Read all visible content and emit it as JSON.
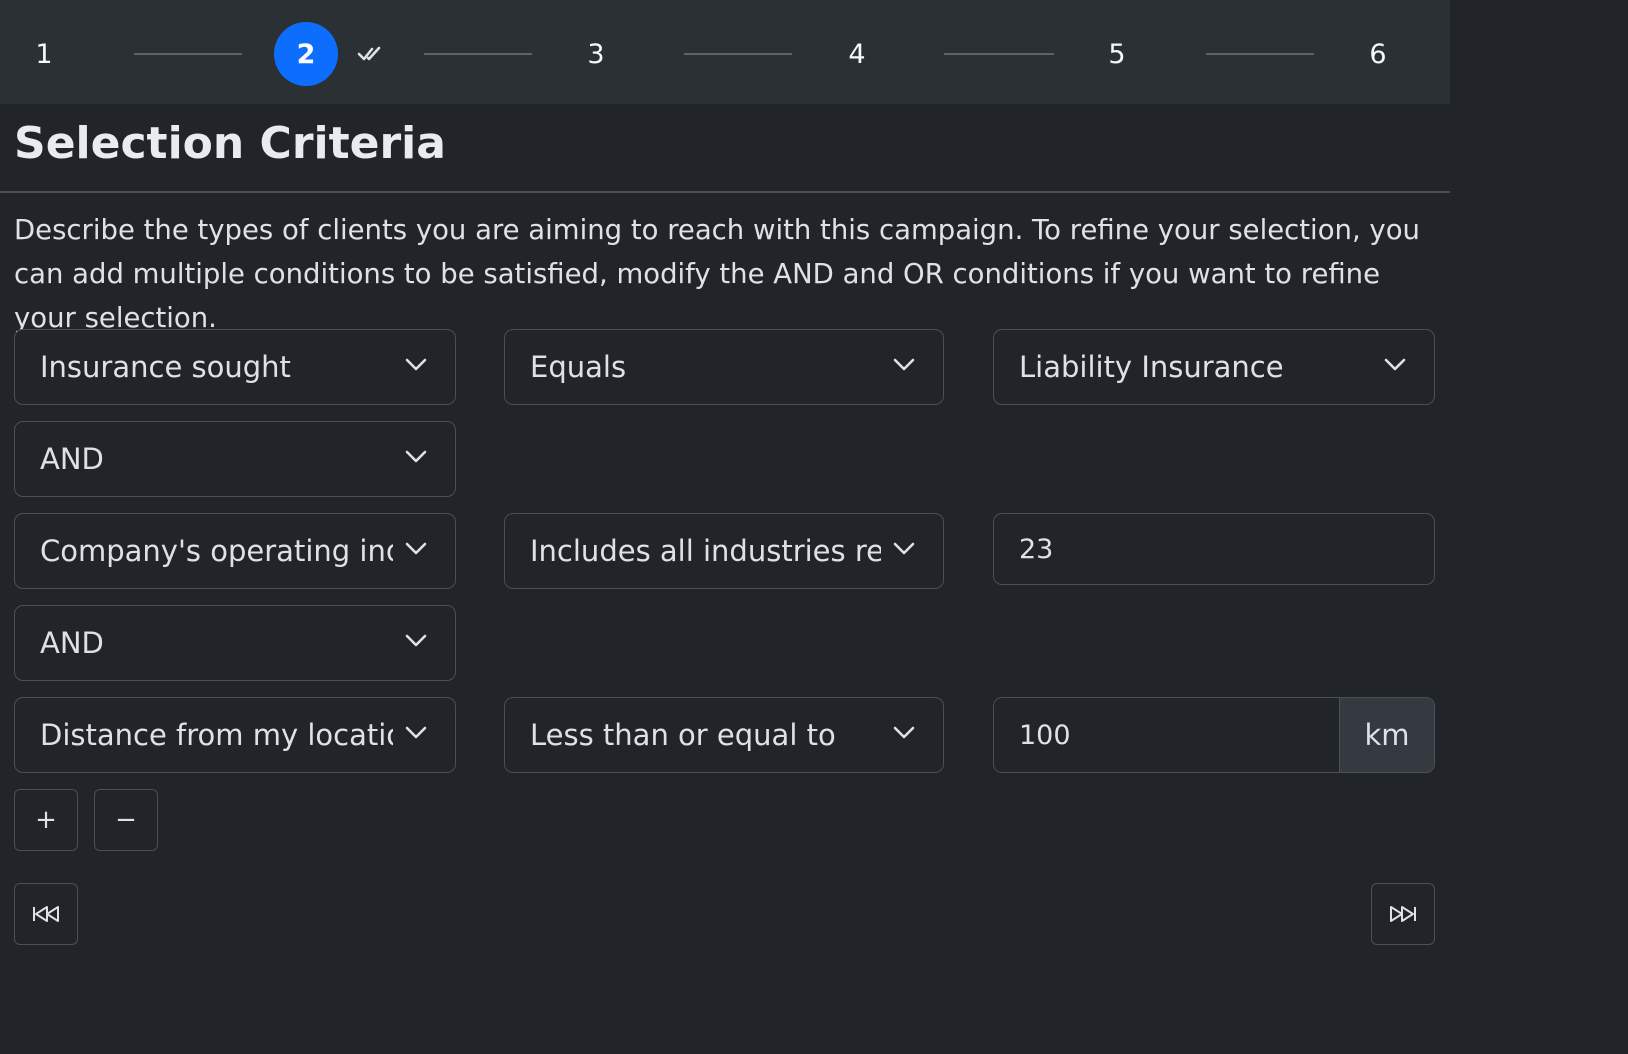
{
  "stepper": {
    "steps": [
      {
        "label": "1",
        "state": "default"
      },
      {
        "label": "2",
        "state": "active",
        "completed_icon": "double-check-icon"
      },
      {
        "label": "3",
        "state": "default"
      },
      {
        "label": "4",
        "state": "default"
      },
      {
        "label": "5",
        "state": "default"
      },
      {
        "label": "6",
        "state": "default"
      }
    ]
  },
  "page": {
    "title": "Selection Criteria",
    "description": "Describe the types of clients you are aiming to reach with this campaign. To refine your selection, you can add multiple conditions to be satisfied, modify the AND and OR conditions if you want to refine your selection."
  },
  "criteria": {
    "row1": {
      "field": "Insurance sought",
      "operator": "Equals",
      "value": "Liability Insurance"
    },
    "connector1": "AND",
    "row2": {
      "field": "Company's operating industry",
      "operator": "Includes all industries related to",
      "value": "23"
    },
    "connector2": "AND",
    "row3": {
      "field": "Distance from my location",
      "operator": "Less than or equal to",
      "value": "100",
      "unit": "km"
    }
  },
  "actions": {
    "add_label": "+",
    "remove_label": "−",
    "first_icon": "skip-backward-icon",
    "last_icon": "skip-forward-icon"
  },
  "colors": {
    "background": "#212529",
    "stepper_bg": "#2b3035",
    "accent": "#0d6efd",
    "border": "#495057"
  }
}
